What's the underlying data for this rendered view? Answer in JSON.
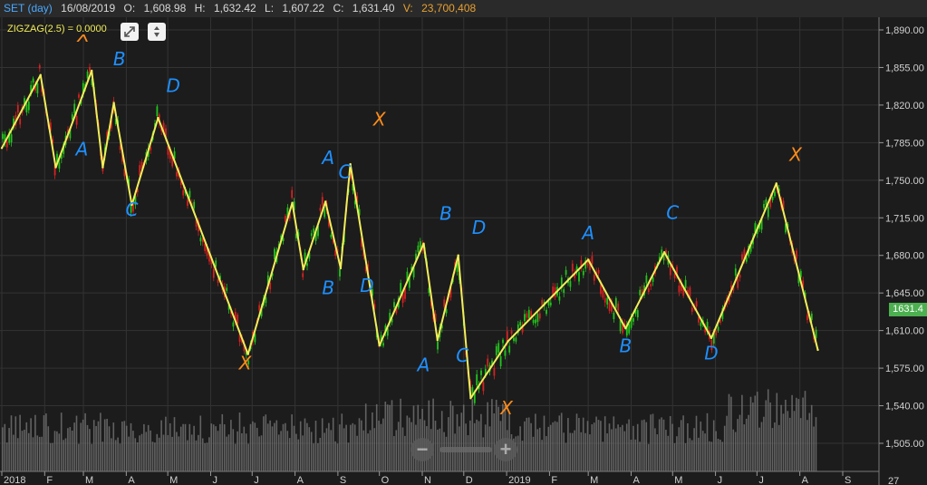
{
  "header": {
    "symbol": "SET (day)",
    "date": "16/08/2019",
    "open_label": "O:",
    "open": "1,608.98",
    "high_label": "H:",
    "high": "1,632.42",
    "low_label": "L:",
    "low": "1,607.22",
    "close_label": "C:",
    "close": "1,631.40",
    "volume_label": "V:",
    "volume": "23,700,408"
  },
  "indicator_label": "ZIGZAG(2.5) = 0.0000",
  "last_price_tag": "1631.4",
  "colors": {
    "background": "#1c1c1c",
    "grid": "#333333",
    "up_candle": "#22c41c",
    "down_candle": "#d42222",
    "zigzag": "#f2ee5a",
    "volume": "#7a7a7a",
    "annotation_blue": "#1e90ff",
    "annotation_orange": "#ff8c1a",
    "last_price_bg": "#4caf50"
  },
  "icons": [
    "expand-icon",
    "settings-icon",
    "zoom-out-icon",
    "zoom-in-icon"
  ],
  "chart_data": {
    "type": "line",
    "series": [
      {
        "name": "ZIGZAG(2.5)",
        "x": [
          "2018-01-01",
          "2018-01-29",
          "2018-02-09",
          "2018-03-07",
          "2018-03-15",
          "2018-03-23",
          "2018-04-05",
          "2018-04-24",
          "2018-06-28",
          "2018-07-30",
          "2018-08-07",
          "2018-08-23",
          "2018-09-03",
          "2018-09-10",
          "2018-10-01",
          "2018-11-02",
          "2018-11-12",
          "2018-11-27",
          "2018-12-06",
          "2019-01-02",
          "2019-03-01",
          "2019-03-28",
          "2019-04-25",
          "2019-05-29",
          "2019-07-15",
          "2019-08-14"
        ],
        "values": [
          1780,
          1848,
          1762,
          1852,
          1762,
          1822,
          1727,
          1808,
          1588,
          1729,
          1667,
          1730,
          1668,
          1765,
          1596,
          1691,
          1601,
          1680,
          1547,
          1600,
          1676,
          1612,
          1683,
          1603,
          1747,
          1592
        ]
      }
    ],
    "y_ticks": [
      "1,890.00",
      "1,855.00",
      "1,820.00",
      "1,785.00",
      "1,750.00",
      "1,715.00",
      "1,680.00",
      "1,645.00",
      "1,610.00",
      "1,575.00",
      "1,540.00",
      "1,505.00"
    ],
    "x_ticks": [
      "2018",
      "F",
      "M",
      "A",
      "M",
      "J",
      "J",
      "A",
      "S",
      "O",
      "N",
      "D",
      "2019",
      "F",
      "M",
      "A",
      "M",
      "J",
      "J",
      "A",
      "S"
    ],
    "ylim": [
      1490,
      1900
    ],
    "volume_axis_label": "27",
    "grid": true,
    "annotations": [
      {
        "label": "X",
        "x": "2018-03-01",
        "price": 1879,
        "color": "orange"
      },
      {
        "label": "A",
        "x": "2018-02-28",
        "price": 1773,
        "color": "blue"
      },
      {
        "label": "B",
        "x": "2018-03-27",
        "price": 1857,
        "color": "blue"
      },
      {
        "label": "C",
        "x": "2018-04-05",
        "price": 1717,
        "color": "blue"
      },
      {
        "label": "D",
        "x": "2018-05-05",
        "price": 1832,
        "color": "blue"
      },
      {
        "label": "X",
        "x": "2018-06-26",
        "price": 1574,
        "color": "orange"
      },
      {
        "label": "A",
        "x": "2018-08-25",
        "price": 1765,
        "color": "blue"
      },
      {
        "label": "B",
        "x": "2018-08-25",
        "price": 1644,
        "color": "blue"
      },
      {
        "label": "C",
        "x": "2018-09-06",
        "price": 1752,
        "color": "blue"
      },
      {
        "label": "D",
        "x": "2018-09-22",
        "price": 1646,
        "color": "blue"
      },
      {
        "label": "X",
        "x": "2018-10-01",
        "price": 1801,
        "color": "orange"
      },
      {
        "label": "A",
        "x": "2018-11-02",
        "price": 1572,
        "color": "blue"
      },
      {
        "label": "B",
        "x": "2018-11-18",
        "price": 1713,
        "color": "blue"
      },
      {
        "label": "C",
        "x": "2018-11-30",
        "price": 1581,
        "color": "blue"
      },
      {
        "label": "D",
        "x": "2018-12-12",
        "price": 1700,
        "color": "blue"
      },
      {
        "label": "X",
        "x": "2019-01-01",
        "price": 1532,
        "color": "orange"
      },
      {
        "label": "A",
        "x": "2019-03-01",
        "price": 1695,
        "color": "blue"
      },
      {
        "label": "B",
        "x": "2019-03-28",
        "price": 1590,
        "color": "blue"
      },
      {
        "label": "C",
        "x": "2019-05-01",
        "price": 1714,
        "color": "blue"
      },
      {
        "label": "D",
        "x": "2019-05-29",
        "price": 1583,
        "color": "blue"
      },
      {
        "label": "X",
        "x": "2019-07-29",
        "price": 1768,
        "color": "orange"
      }
    ]
  }
}
